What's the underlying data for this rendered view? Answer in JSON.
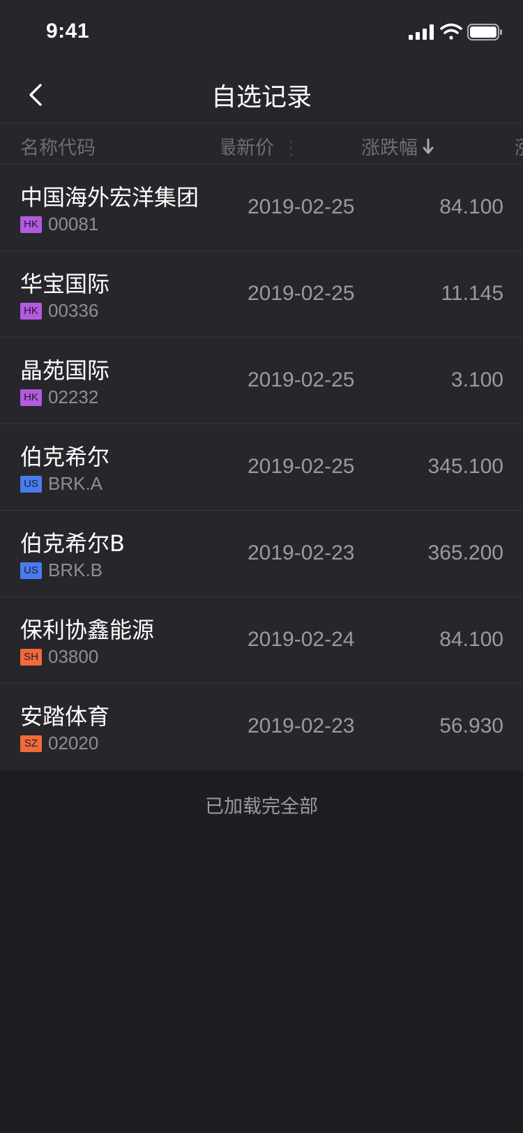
{
  "status_bar": {
    "time": "9:41",
    "icons": [
      "cellular-signal-icon",
      "wifi-icon",
      "battery-icon"
    ]
  },
  "nav": {
    "back_icon": "chevron-left-icon",
    "title": "自选记录"
  },
  "table": {
    "headers": {
      "name": "名称代码",
      "price": "最新价",
      "change": "涨跌幅",
      "extra": "涨"
    },
    "sort_icon": "arrow-down-icon",
    "rows": [
      {
        "name": "中国海外宏洋集团",
        "market": "HK",
        "code": "00081",
        "date": "2019-02-25",
        "value": "84.100"
      },
      {
        "name": "华宝国际",
        "market": "HK",
        "code": "00336",
        "date": "2019-02-25",
        "value": "11.145"
      },
      {
        "name": "晶苑国际",
        "market": "HK",
        "code": "02232",
        "date": "2019-02-25",
        "value": "3.100"
      },
      {
        "name": "伯克希尔",
        "market": "US",
        "code": "BRK.A",
        "date": "2019-02-25",
        "value": "345.100"
      },
      {
        "name": "伯克希尔B",
        "market": "US",
        "code": "BRK.B",
        "date": "2019-02-23",
        "value": "365.200"
      },
      {
        "name": "保利协鑫能源",
        "market": "SH",
        "code": "03800",
        "date": "2019-02-24",
        "value": "84.100"
      },
      {
        "name": "安踏体育",
        "market": "SZ",
        "code": "02020",
        "date": "2019-02-23",
        "value": "56.930"
      }
    ]
  },
  "market_colors": {
    "HK": "#b35ae0",
    "US": "#4a7cf0",
    "SH": "#f26a3a",
    "SZ": "#f26a3a"
  },
  "footer": {
    "text": "已加载完全部"
  }
}
